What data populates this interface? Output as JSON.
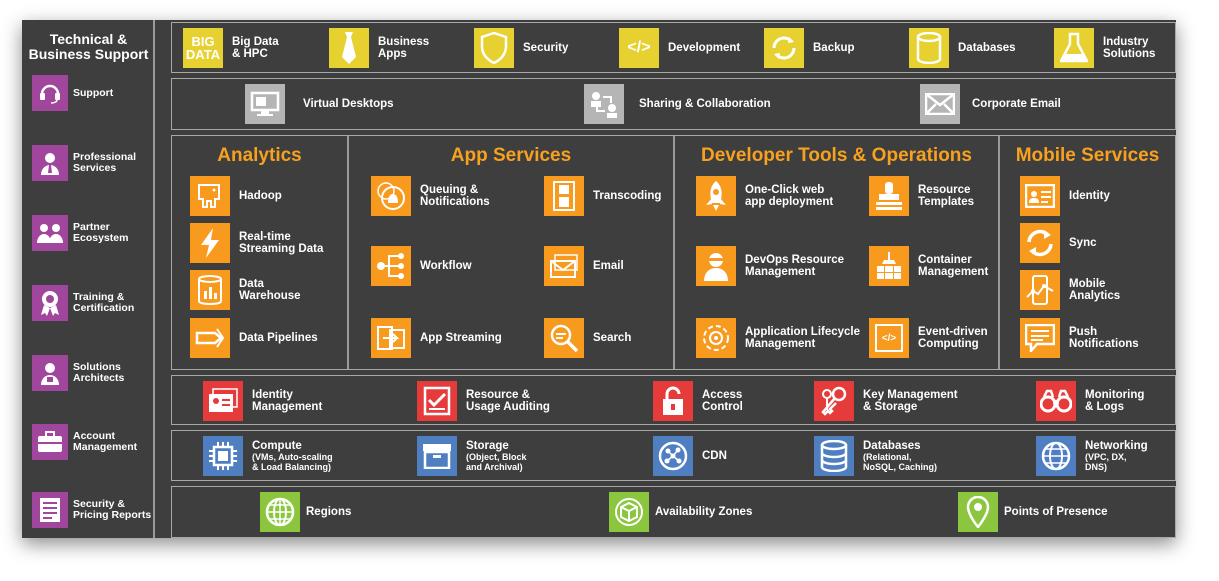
{
  "sidebar": {
    "title_line1": "Technical &",
    "title_line2": "Business Support",
    "items": [
      {
        "l1": "Support",
        "l2": ""
      },
      {
        "l1": "Professional",
        "l2": "Services"
      },
      {
        "l1": "Partner",
        "l2": "Ecosystem"
      },
      {
        "l1": "Training &",
        "l2": "Certification"
      },
      {
        "l1": "Solutions",
        "l2": "Architects"
      },
      {
        "l1": "Account",
        "l2": "Management"
      },
      {
        "l1": "Security &",
        "l2": "Pricing Reports"
      }
    ]
  },
  "row1": [
    {
      "l1": "Big Data",
      "l2": "& HPC",
      "icon_text1": "BIG",
      "icon_text2": "DATA"
    },
    {
      "l1": "Business",
      "l2": "Apps"
    },
    {
      "l1": "Security",
      "l2": ""
    },
    {
      "l1": "Development",
      "l2": "",
      "icon_text": "</>"
    },
    {
      "l1": "Backup",
      "l2": ""
    },
    {
      "l1": "Databases",
      "l2": ""
    },
    {
      "l1": "Industry",
      "l2": "Solutions"
    }
  ],
  "row2": [
    {
      "l1": "Virtual Desktops"
    },
    {
      "l1": "Sharing & Collaboration"
    },
    {
      "l1": "Corporate Email"
    }
  ],
  "sections": {
    "analytics": {
      "title": "Analytics",
      "items": [
        {
          "l1": "Hadoop",
          "l2": ""
        },
        {
          "l1": "Real-time",
          "l2": "Streaming Data"
        },
        {
          "l1": "Data",
          "l2": "Warehouse"
        },
        {
          "l1": "Data Pipelines",
          "l2": ""
        }
      ]
    },
    "app_services": {
      "title": "App Services",
      "items": [
        {
          "l1": "Queuing &",
          "l2": "Notifications"
        },
        {
          "l1": "Transcoding",
          "l2": ""
        },
        {
          "l1": "Workflow",
          "l2": ""
        },
        {
          "l1": "Email",
          "l2": ""
        },
        {
          "l1": "App Streaming",
          "l2": ""
        },
        {
          "l1": "Search",
          "l2": ""
        }
      ]
    },
    "dev_tools": {
      "title": "Developer Tools & Operations",
      "items": [
        {
          "l1": "One-Click web",
          "l2": "app deployment"
        },
        {
          "l1": "Resource",
          "l2": "Templates"
        },
        {
          "l1": "DevOps Resource",
          "l2": "Management"
        },
        {
          "l1": "Container",
          "l2": "Management"
        },
        {
          "l1": "Application Lifecycle",
          "l2": "Management"
        },
        {
          "l1": "Event-driven",
          "l2": "Computing",
          "icon_text": "</>"
        }
      ]
    },
    "mobile": {
      "title": "Mobile Services",
      "items": [
        {
          "l1": "Identity",
          "l2": ""
        },
        {
          "l1": "Sync",
          "l2": ""
        },
        {
          "l1": "Mobile",
          "l2": "Analytics"
        },
        {
          "l1": "Push",
          "l2": "Notifications"
        }
      ]
    }
  },
  "row_security": [
    {
      "l1": "Identity",
      "l2": "Management"
    },
    {
      "l1": "Resource &",
      "l2": "Usage Auditing"
    },
    {
      "l1": "Access",
      "l2": "Control"
    },
    {
      "l1": "Key Management",
      "l2": "& Storage"
    },
    {
      "l1": "Monitoring",
      "l2": "& Logs"
    }
  ],
  "row_core": [
    {
      "l1": "Compute",
      "s1": "(VMs, Auto-scaling",
      "s2": "& Load Balancing)"
    },
    {
      "l1": "Storage",
      "s1": "(Object, Block",
      "s2": "and Archival)"
    },
    {
      "l1": "CDN",
      "s1": "",
      "s2": ""
    },
    {
      "l1": "Databases",
      "s1": "(Relational,",
      "s2": "NoSQL, Caching)"
    },
    {
      "l1": "Networking",
      "s1": "(VPC, DX,",
      "s2": "DNS)"
    }
  ],
  "row_infra": [
    {
      "l1": "Regions"
    },
    {
      "l1": "Availability Zones"
    },
    {
      "l1": "Points of Presence"
    }
  ],
  "colors": {
    "background": "#3e3e3e",
    "yellow": "#e6d131",
    "orange": "#f79a1e",
    "purple": "#a0469d",
    "red": "#e63b3b",
    "blue": "#4f7fc1",
    "green": "#8cc63f",
    "grey": "#b5b5b5"
  }
}
